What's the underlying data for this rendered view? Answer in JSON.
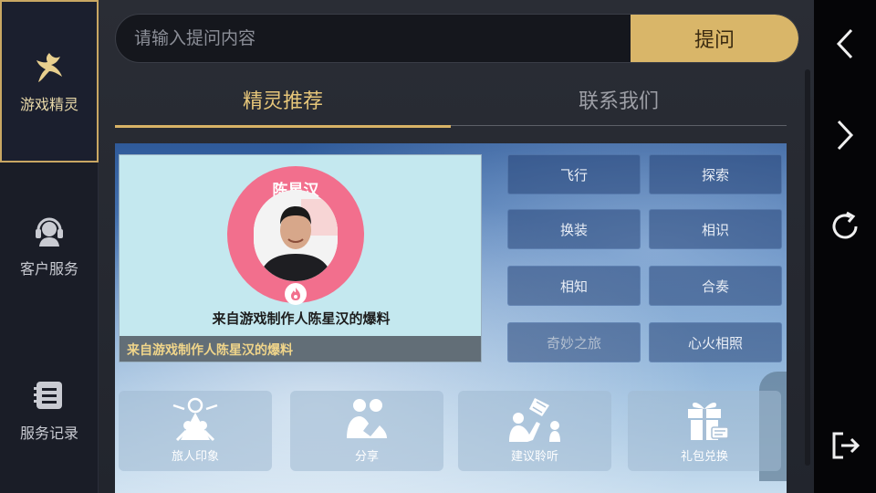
{
  "sidebar": {
    "items": [
      {
        "label": "游戏精灵",
        "icon": "sprite-icon",
        "active": true
      },
      {
        "label": "客户服务",
        "icon": "headset-icon",
        "active": false
      },
      {
        "label": "服务记录",
        "icon": "records-icon",
        "active": false
      }
    ]
  },
  "search": {
    "placeholder": "请输入提问内容",
    "value": "",
    "button_label": "提问"
  },
  "tabs": [
    {
      "label": "精灵推荐",
      "active": true
    },
    {
      "label": "联系我们",
      "active": false
    }
  ],
  "banner": {
    "ring_label": "陈星汉",
    "caption": "来自游戏制作人陈星汉的爆料",
    "bar_text": "来自游戏制作人陈星汉的爆料"
  },
  "quick_buttons": [
    "飞行",
    "探索",
    "换装",
    "相识",
    "相知",
    "合奏",
    "奇妙之旅",
    "心火相照"
  ],
  "tiles": [
    {
      "label": "旅人印象",
      "icon": "traveler-icon"
    },
    {
      "label": "分享",
      "icon": "share-icon"
    },
    {
      "label": "建议聆听",
      "icon": "suggestion-icon"
    },
    {
      "label": "礼包兑换",
      "icon": "gift-icon"
    }
  ],
  "right_nav": {
    "icons": [
      "back-icon",
      "forward-icon",
      "refresh-icon",
      "exit-icon"
    ]
  },
  "colors": {
    "accent_gold": "#d9b669",
    "active_tab_text": "#e7c77a",
    "sidebar_bg": "#1a1d27",
    "ring_pink": "#f26f8d"
  }
}
